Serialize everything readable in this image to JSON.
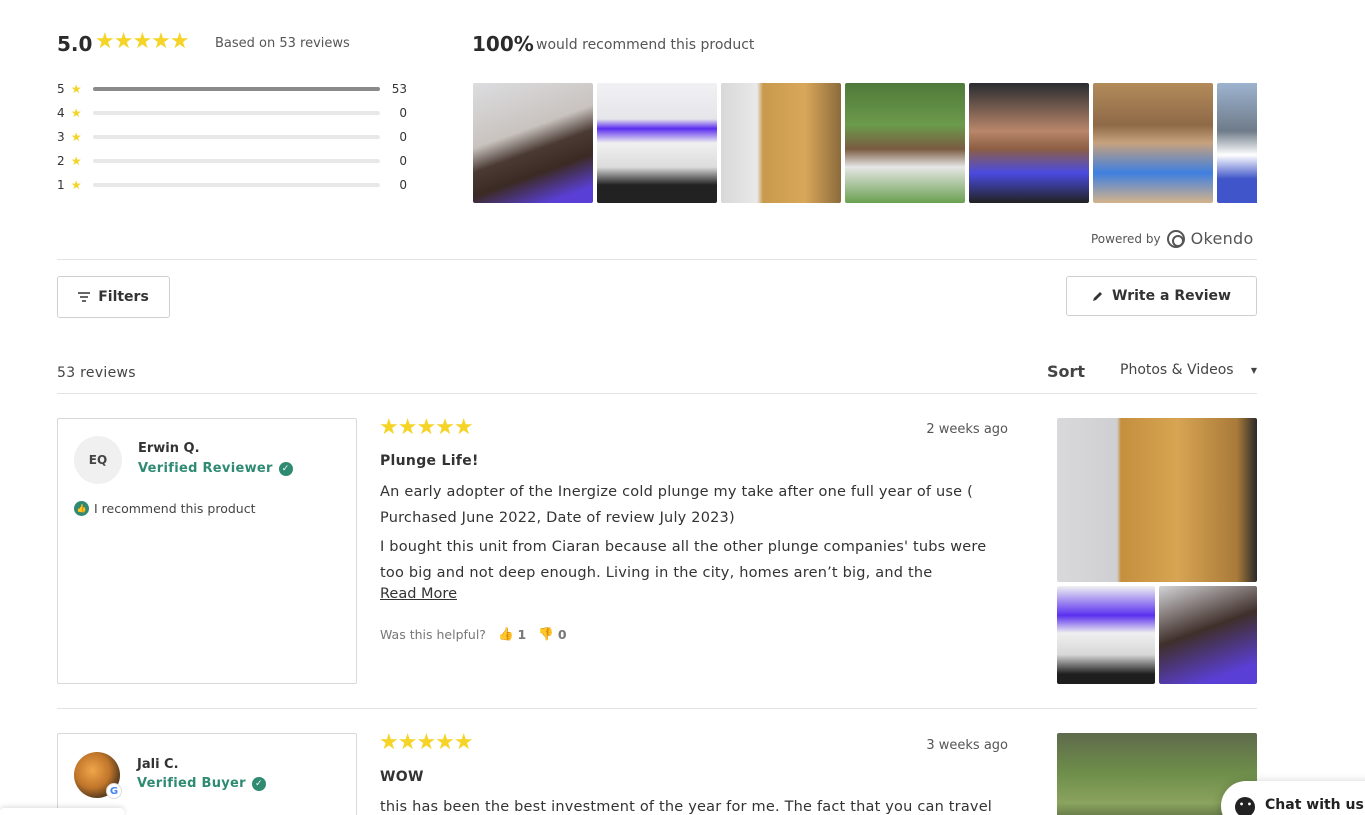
{
  "summary": {
    "average": "5.0",
    "based_on": "Based on 53 reviews",
    "recommend_pct": "100%",
    "recommend_text": "would recommend this product",
    "breakdown": [
      {
        "stars": "5",
        "count": "53",
        "fraction": 1.0
      },
      {
        "stars": "4",
        "count": "0",
        "fraction": 0
      },
      {
        "stars": "3",
        "count": "0",
        "fraction": 0
      },
      {
        "stars": "2",
        "count": "0",
        "fraction": 0
      },
      {
        "stars": "1",
        "count": "0",
        "fraction": 0
      }
    ]
  },
  "powered": {
    "label": "Powered by",
    "brand": "Okendo"
  },
  "toolbar": {
    "filters_label": "Filters",
    "write_label": "Write a Review",
    "review_count": "53 reviews",
    "sort_label": "Sort",
    "sort_value": "Photos & Videos"
  },
  "reviews": [
    {
      "initials": "EQ",
      "author": "Erwin Q.",
      "badge": "Verified Reviewer",
      "recommend": "I recommend this product",
      "date": "2 weeks ago",
      "title": "Plunge Life!",
      "paragraph1": "An early adopter of the Inergize cold plunge my take after one full year of use ( Purchased June 2022, Date of review July 2023)",
      "paragraph2": "I bought this unit from Ciaran because all the other plunge companies' tubs were too big and not deep enough. Living in the city, homes aren’t big, and the",
      "read_more": "Read More",
      "helpful_label": "Was this helpful?",
      "helpful_yes": "1",
      "helpful_no": "0"
    },
    {
      "author": "Jali C.",
      "badge": "Verified Buyer",
      "date": "3 weeks ago",
      "title": "WOW",
      "paragraph1": "this has been the best investment of the year for me. The fact that you can travel"
    }
  ],
  "chat": {
    "label": "Chat with us"
  },
  "colors": {
    "star": "#f5d327",
    "verified": "#2f8a72"
  }
}
